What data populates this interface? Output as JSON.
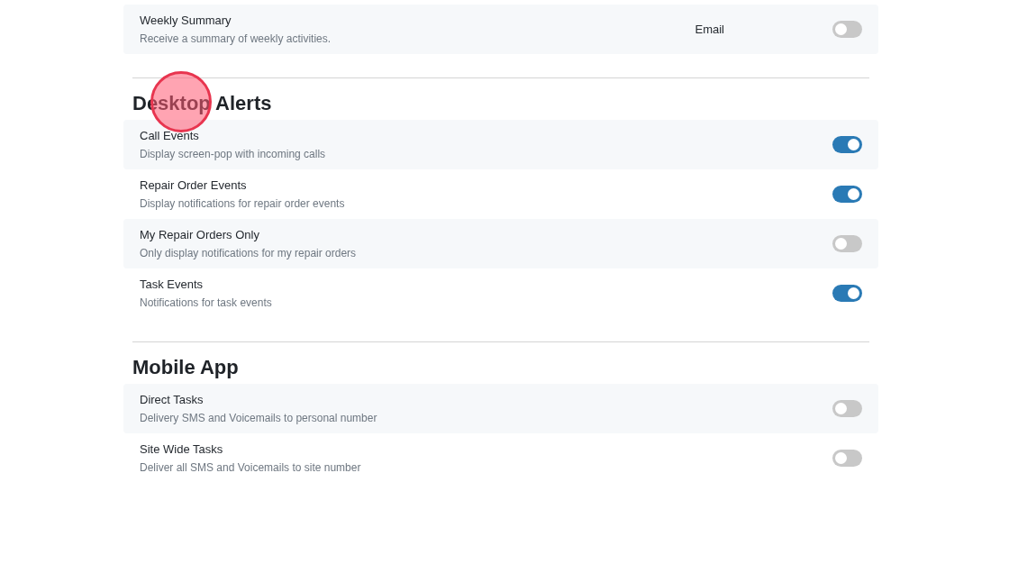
{
  "sections": [
    {
      "rows": [
        {
          "title": "Weekly Summary",
          "description": "Receive a summary of weekly activities.",
          "channel": "Email",
          "on": false
        }
      ]
    },
    {
      "heading": "Desktop Alerts",
      "click_marker": true,
      "rows": [
        {
          "title": "Call Events",
          "description": "Display screen-pop with incoming calls",
          "on": true
        },
        {
          "title": "Repair Order Events",
          "description": "Display notifications for repair order events",
          "on": true
        },
        {
          "title": "My Repair Orders Only",
          "description": "Only display notifications for my repair orders",
          "on": false
        },
        {
          "title": "Task Events",
          "description": "Notifications for task events",
          "on": true
        }
      ]
    },
    {
      "heading": "Mobile App",
      "rows": [
        {
          "title": "Direct Tasks",
          "description": "Delivery SMS and Voicemails to personal number",
          "on": false
        },
        {
          "title": "Site Wide Tasks",
          "description": "Deliver all SMS and Voicemails to site number",
          "on": false
        }
      ]
    }
  ]
}
